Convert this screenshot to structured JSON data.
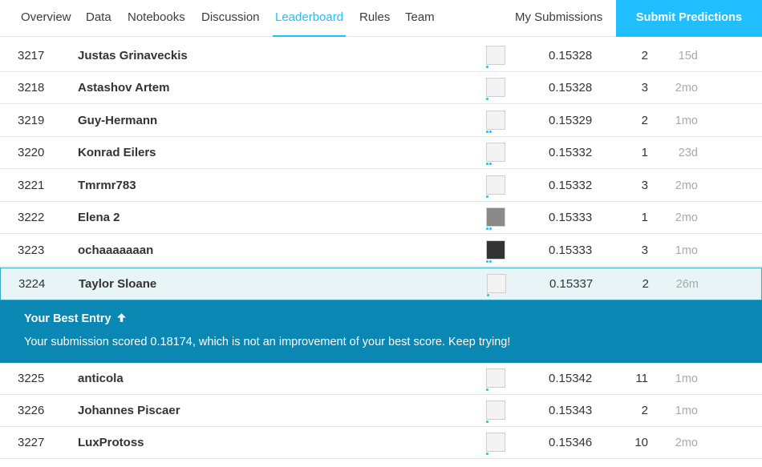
{
  "nav": {
    "tabs": [
      {
        "label": "Overview",
        "active": false
      },
      {
        "label": "Data",
        "active": false
      },
      {
        "label": "Notebooks",
        "active": false
      },
      {
        "label": "Discussion",
        "active": false
      },
      {
        "label": "Leaderboard",
        "active": true
      },
      {
        "label": "Rules",
        "active": false
      },
      {
        "label": "Team",
        "active": false
      }
    ],
    "my_submissions": "My Submissions",
    "submit_predictions": "Submit Predictions"
  },
  "rows": [
    {
      "rank": "3217",
      "team": "Justas Grinaveckis",
      "score": "0.15328",
      "entries": "2",
      "last": "15d",
      "team_members": 1,
      "avatar": "light"
    },
    {
      "rank": "3218",
      "team": "Astashov Artem",
      "score": "0.15328",
      "entries": "3",
      "last": "2mo",
      "team_members": 1,
      "avatar": "light"
    },
    {
      "rank": "3219",
      "team": "Guy-Hermann",
      "score": "0.15329",
      "entries": "2",
      "last": "1mo",
      "team_members": 2,
      "avatar": "light"
    },
    {
      "rank": "3220",
      "team": "Konrad Eilers",
      "score": "0.15332",
      "entries": "1",
      "last": "23d",
      "team_members": 2,
      "avatar": "light"
    },
    {
      "rank": "3221",
      "team": "Tmrmr783",
      "score": "0.15332",
      "entries": "3",
      "last": "2mo",
      "team_members": 1,
      "avatar": "light"
    },
    {
      "rank": "3222",
      "team": "Elena 2",
      "score": "0.15333",
      "entries": "1",
      "last": "2mo",
      "team_members": 2,
      "avatar": "gray"
    },
    {
      "rank": "3223",
      "team": "ochaaaaaaan",
      "score": "0.15333",
      "entries": "3",
      "last": "1mo",
      "team_members": 2,
      "avatar": "dark"
    },
    {
      "rank": "3224",
      "team": "Taylor Sloane",
      "score": "0.15337",
      "entries": "2",
      "last": "26m",
      "team_members": 1,
      "avatar": "light",
      "me": true
    }
  ],
  "banner": {
    "title": "Your Best Entry",
    "title_icon": "arrow-up-icon",
    "message": "Your submission scored 0.18174, which is not an improvement of your best score. Keep trying!"
  },
  "rows_after": [
    {
      "rank": "3225",
      "team": "anticola",
      "score": "0.15342",
      "entries": "11",
      "last": "1mo",
      "team_members": 1,
      "avatar": "light"
    },
    {
      "rank": "3226",
      "team": "Johannes Piscaer",
      "score": "0.15343",
      "entries": "2",
      "last": "1mo",
      "team_members": 1,
      "avatar": "light"
    },
    {
      "rank": "3227",
      "team": "LuxProtoss",
      "score": "0.15346",
      "entries": "10",
      "last": "2mo",
      "team_members": 1,
      "avatar": "light"
    }
  ],
  "colors": {
    "accent": "#20beff",
    "banner": "#0a87b2",
    "highlight_row": "#e8f4f6"
  }
}
